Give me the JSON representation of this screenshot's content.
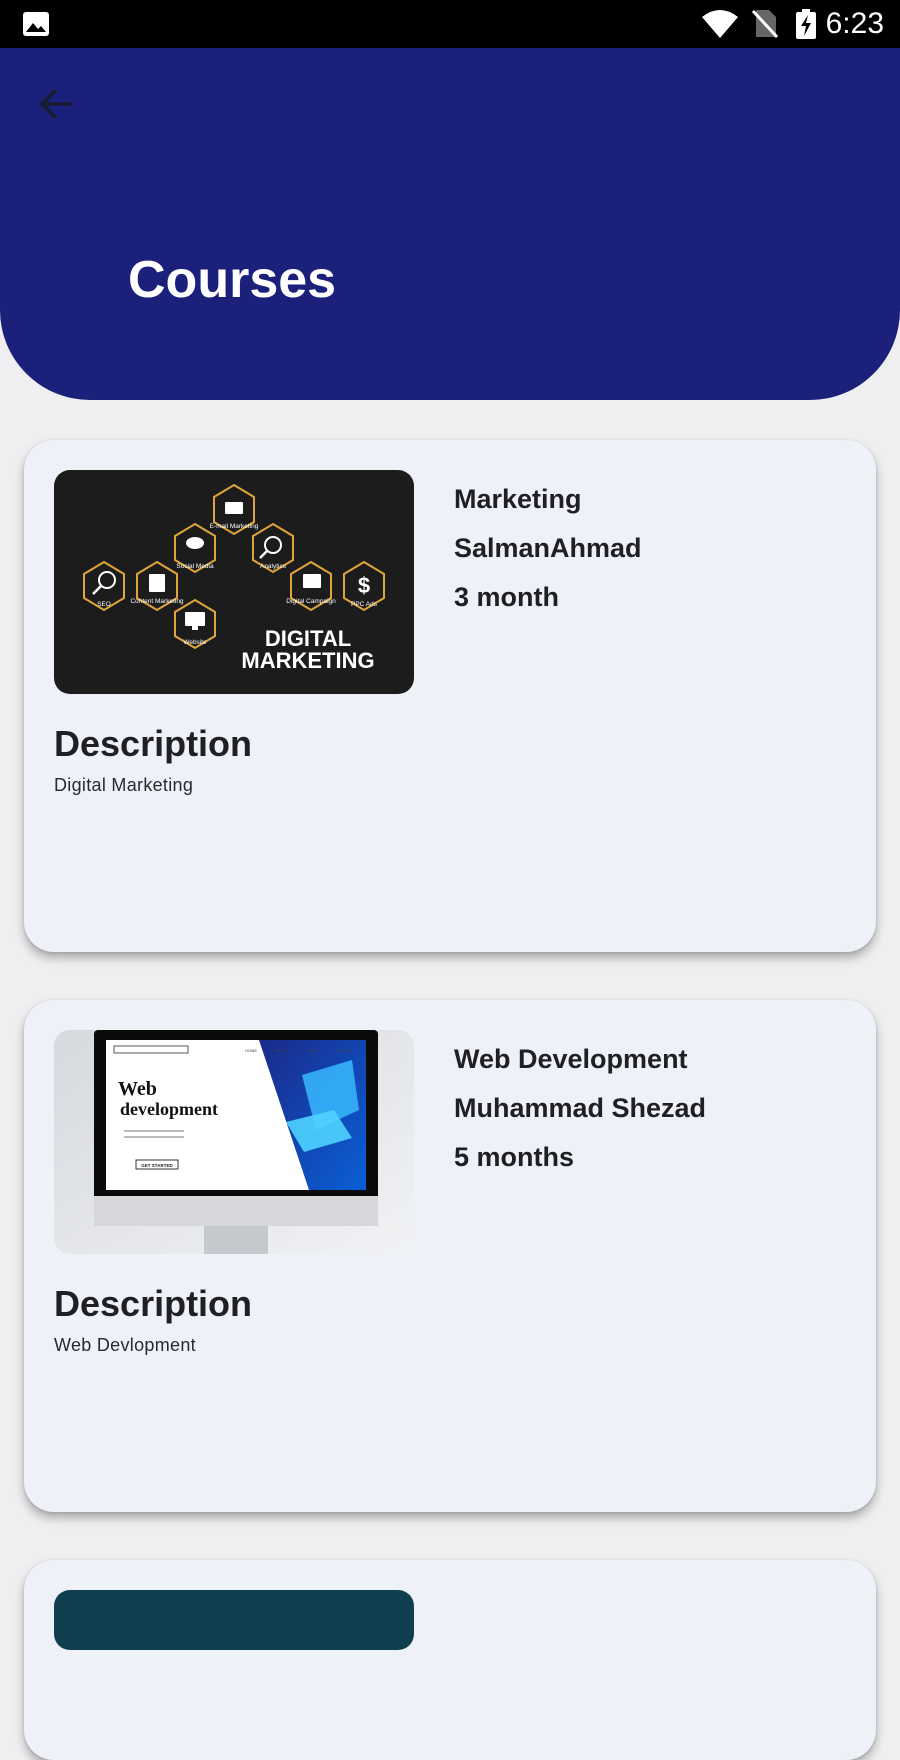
{
  "status_bar": {
    "time": "6:23",
    "icons": [
      "image-notification-icon",
      "wifi-icon",
      "no-sim-icon",
      "battery-charging-icon"
    ]
  },
  "header": {
    "back_icon": "arrow-left-icon",
    "title": "Courses",
    "color": "#1b217b"
  },
  "courses": [
    {
      "name": "Marketing",
      "instructor": "SalmanAhmad",
      "duration": "3 month",
      "description_heading": "Description",
      "description": "Digital Marketing",
      "image": {
        "theme": "digital-marketing",
        "items": [
          "E-mail Marketing",
          "Social Media",
          "Analytics",
          "SEO",
          "Content Marketing",
          "Digital Campaign",
          "PPC Ads",
          "Website"
        ],
        "caption_line1": "DIGITAL",
        "caption_line2": "MARKETING"
      }
    },
    {
      "name": "Web Development",
      "instructor": "Muhammad Shezad",
      "duration": "5 months",
      "description_heading": "Description",
      "description": "Web Devlopment",
      "image": {
        "theme": "web-development",
        "nav": [
          "HOME",
          "ABOUT",
          "NEWS",
          "CONTACT"
        ],
        "headline_line1": "Web",
        "headline_line2": "development",
        "button": "GET STARTED"
      }
    }
  ]
}
